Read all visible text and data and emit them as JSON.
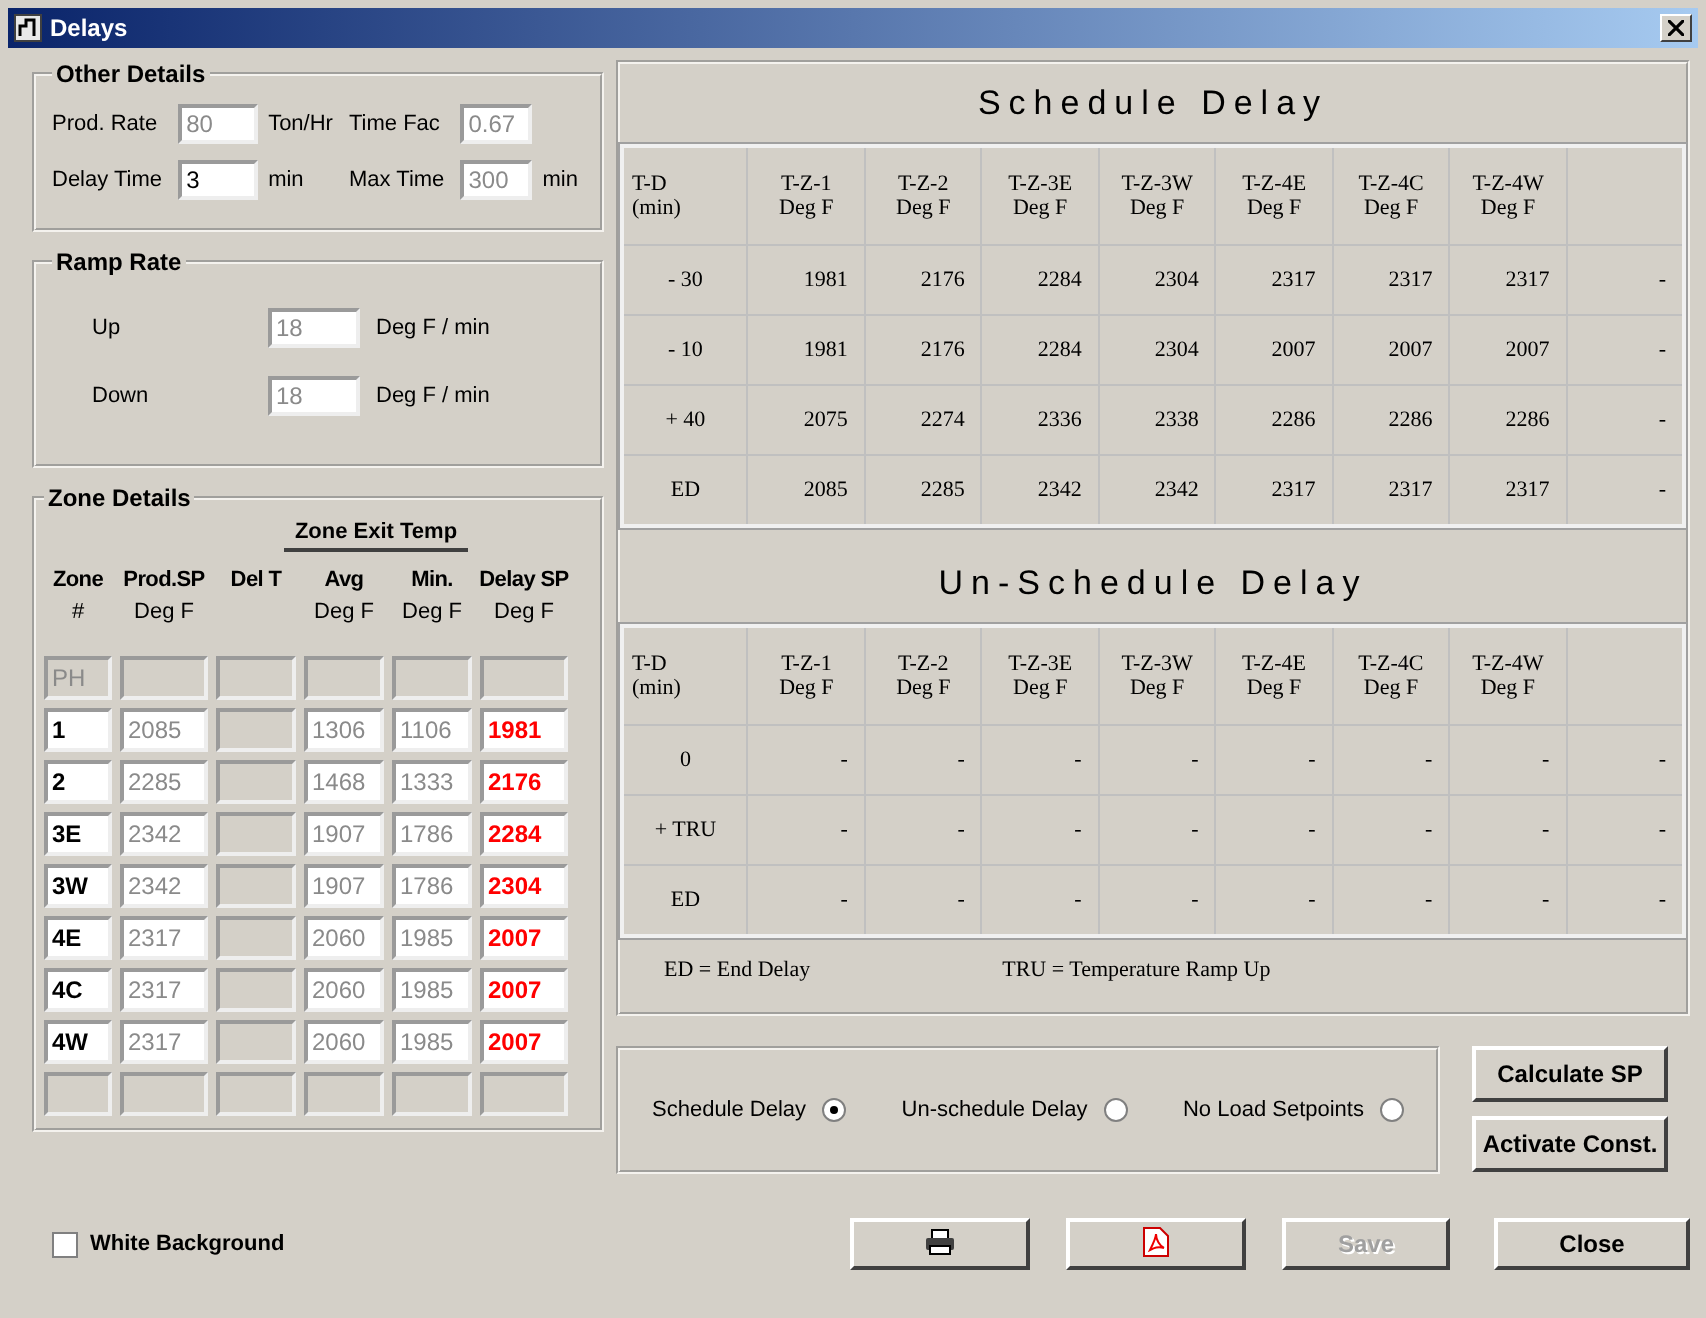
{
  "window": {
    "title": "Delays"
  },
  "other_details": {
    "title": "Other Details",
    "fields": [
      {
        "label": "Prod.  Rate",
        "value": "80",
        "unit": "Ton/Hr",
        "disabled": true
      },
      {
        "label": "Time Fac",
        "value": "0.67",
        "disabled": true
      },
      {
        "label": "Delay Time",
        "value": "3",
        "unit": "min",
        "disabled": false
      },
      {
        "label": "Max Time",
        "value": "300",
        "unit": "min",
        "disabled": true
      }
    ]
  },
  "ramp_rate": {
    "title": "Ramp Rate",
    "fields": [
      {
        "label": "Up",
        "value": "18",
        "unit": "Deg F / min",
        "disabled": true
      },
      {
        "label": "Down",
        "value": "18",
        "unit": "Deg F / min",
        "disabled": true
      }
    ]
  },
  "zone_details": {
    "title": "Zone  Details",
    "group_header": "Zone Exit Temp",
    "columns": [
      {
        "name": "Zone",
        "unit": "#"
      },
      {
        "name": "Prod.SP",
        "unit": "Deg F"
      },
      {
        "name": "Del T"
      },
      {
        "name": "Avg",
        "unit": "Deg F"
      },
      {
        "name": "Min.",
        "unit": "Deg F"
      },
      {
        "name": "Delay SP",
        "unit": "Deg F"
      }
    ],
    "rows": [
      {
        "zone": "PH",
        "disabled": true
      },
      {
        "zone": "1",
        "prod_sp": "2085",
        "avg": "1306",
        "min": "1106",
        "delay_sp": "1981",
        "disabled": false
      },
      {
        "zone": "2",
        "prod_sp": "2285",
        "avg": "1468",
        "min": "1333",
        "delay_sp": "2176",
        "disabled": false
      },
      {
        "zone": "3E",
        "prod_sp": "2342",
        "avg": "1907",
        "min": "1786",
        "delay_sp": "2284",
        "disabled": false
      },
      {
        "zone": "3W",
        "prod_sp": "2342",
        "avg": "1907",
        "min": "1786",
        "delay_sp": "2304",
        "disabled": false
      },
      {
        "zone": "4E",
        "prod_sp": "2317",
        "avg": "2060",
        "min": "1985",
        "delay_sp": "2007",
        "disabled": false
      },
      {
        "zone": "4C",
        "prod_sp": "2317",
        "avg": "2060",
        "min": "1985",
        "delay_sp": "2007",
        "disabled": false
      },
      {
        "zone": "4W",
        "prod_sp": "2317",
        "avg": "2060",
        "min": "1985",
        "delay_sp": "2007",
        "disabled": false
      },
      {
        "disabled": true
      }
    ]
  },
  "tables": [
    {
      "title": "Schedule Delay",
      "header_rows": [
        [
          "T-D",
          "T-Z-1",
          "T-Z-2",
          "T-Z-3E",
          "T-Z-3W",
          "T-Z-4E",
          "T-Z-4C",
          "T-Z-4W"
        ],
        [
          "(min)",
          "Deg F",
          "Deg F",
          "Deg F",
          "Deg F",
          "Deg F",
          "Deg F",
          "Deg F"
        ]
      ],
      "rows": [
        [
          "-  30",
          "1981",
          "2176",
          "2284",
          "2304",
          "2317",
          "2317",
          "2317",
          "-"
        ],
        [
          "-  10",
          "1981",
          "2176",
          "2284",
          "2304",
          "2007",
          "2007",
          "2007",
          "-"
        ],
        [
          "+    40",
          "2075",
          "2274",
          "2336",
          "2338",
          "2286",
          "2286",
          "2286",
          "-"
        ],
        [
          "ED",
          "2085",
          "2285",
          "2342",
          "2342",
          "2317",
          "2317",
          "2317",
          "-"
        ]
      ]
    },
    {
      "title": "Un-Schedule Delay",
      "header_rows": [
        [
          "T-D",
          "T-Z-1",
          "T-Z-2",
          "T-Z-3E",
          "T-Z-3W",
          "T-Z-4E",
          "T-Z-4C",
          "T-Z-4W"
        ],
        [
          "(min)",
          "Deg F",
          "Deg F",
          "Deg F",
          "Deg F",
          "Deg F",
          "Deg F",
          "Deg F"
        ]
      ],
      "rows": [
        [
          "0",
          "-",
          "-",
          "-",
          "-",
          "-",
          "-",
          "-",
          "-"
        ],
        [
          "+ TRU",
          "-",
          "-",
          "-",
          "-",
          "-",
          "-",
          "-",
          "-"
        ],
        [
          "ED",
          "-",
          "-",
          "-",
          "-",
          "-",
          "-",
          "-",
          "-"
        ]
      ]
    }
  ],
  "legend": [
    "ED = End Delay",
    "TRU = Temperature Ramp Up"
  ],
  "delay_type": [
    {
      "label": "Schedule Delay",
      "selected": true
    },
    {
      "label": "Un-schedule Delay",
      "selected": false
    },
    {
      "label": "No Load Setpoints",
      "selected": false
    }
  ],
  "side_buttons": [
    {
      "label": "Calculate SP"
    },
    {
      "label": "Activate Const."
    }
  ],
  "white_background": {
    "label": "White Background",
    "checked": false
  },
  "bottom_buttons": [
    {
      "kind": "print"
    },
    {
      "kind": "pdf"
    },
    {
      "kind": "text",
      "label": "Save",
      "disabled": true
    },
    {
      "kind": "text",
      "label": "Close",
      "disabled": false
    }
  ]
}
